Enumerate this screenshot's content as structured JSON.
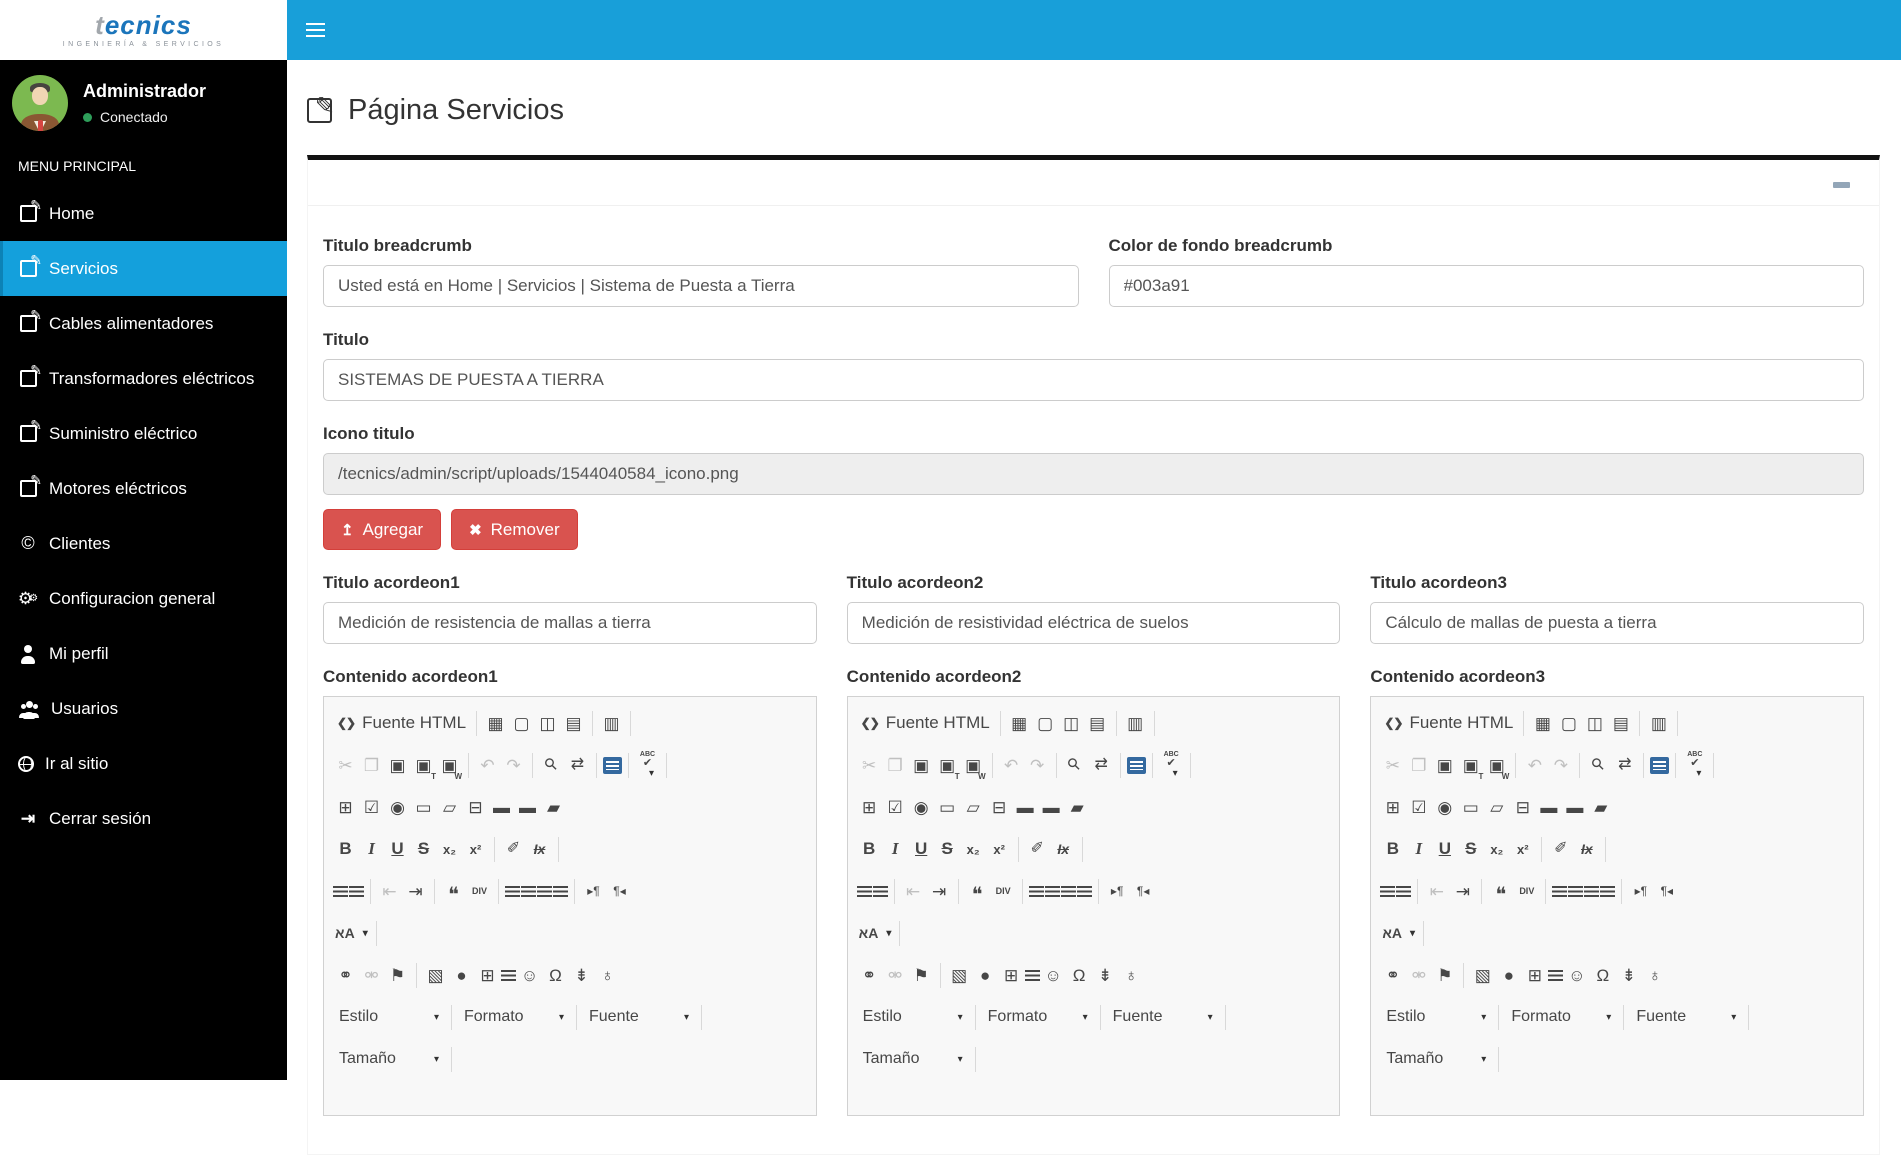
{
  "sidebar": {
    "logo": {
      "brand_prefix": "t",
      "brand_mid": "ecnic",
      "brand_suffix": "s",
      "tagline": "INGENIERÍA & SERVICIOS"
    },
    "user": {
      "name": "Administrador",
      "status": "Conectado"
    },
    "menu_header": "MENU PRINCIPAL",
    "items": [
      {
        "label": "Home",
        "icon": "edit-icon",
        "active": false
      },
      {
        "label": "Servicios",
        "icon": "edit-icon",
        "active": true
      },
      {
        "label": "Cables alimentadores",
        "icon": "edit-icon",
        "active": false
      },
      {
        "label": "Transformadores eléctricos",
        "icon": "edit-icon",
        "active": false
      },
      {
        "label": "Suministro eléctrico",
        "icon": "edit-icon",
        "active": false
      },
      {
        "label": "Motores eléctricos",
        "icon": "edit-icon",
        "active": false
      },
      {
        "label": "Clientes",
        "icon": "copyright-icon",
        "active": false
      },
      {
        "label": "Configuracion general",
        "icon": "gears-icon",
        "active": false
      },
      {
        "label": "Mi perfil",
        "icon": "user-icon",
        "active": false
      },
      {
        "label": "Usuarios",
        "icon": "users-icon",
        "active": false
      },
      {
        "label": "Ir al sitio",
        "icon": "globe-icon",
        "active": false
      },
      {
        "label": "Cerrar sesión",
        "icon": "sign-out-icon",
        "active": false
      }
    ]
  },
  "page": {
    "title": "Página Servicios"
  },
  "form": {
    "titulo_breadcrumb": {
      "label": "Titulo breadcrumb",
      "value": "Usted está en Home | Servicios | Sistema de Puesta a Tierra"
    },
    "color_fondo": {
      "label": "Color de fondo breadcrumb",
      "value": "#003a91"
    },
    "titulo": {
      "label": "Titulo",
      "value": "SISTEMAS DE PUESTA A TIERRA"
    },
    "icono_titulo": {
      "label": "Icono titulo",
      "value": "/tecnics/admin/script/uploads/1544040584_icono.png"
    },
    "agregar_label": "Agregar",
    "remover_label": "Remover",
    "acordeones": [
      {
        "titulo_label": "Titulo acordeon1",
        "titulo_value": "Medición de resistencia de mallas a tierra",
        "contenido_label": "Contenido acordeon1"
      },
      {
        "titulo_label": "Titulo acordeon2",
        "titulo_value": "Medición de resistividad eléctrica de suelos",
        "contenido_label": "Contenido acordeon2"
      },
      {
        "titulo_label": "Titulo acordeon3",
        "titulo_value": "Cálculo de mallas de puesta a tierra",
        "contenido_label": "Contenido acordeon3"
      }
    ]
  },
  "editor": {
    "toolbar_rows": [
      [
        {
          "n": "source-button",
          "g": "❮❯",
          "t": "Fuente HTML",
          "c": "srcbtn"
        },
        {
          "s": 1
        },
        {
          "n": "save-icon",
          "g": "▦"
        },
        {
          "n": "new-page-icon",
          "g": "▢"
        },
        {
          "n": "preview-icon",
          "g": "◫"
        },
        {
          "n": "print-icon",
          "g": "▤"
        },
        {
          "s": 1
        },
        {
          "n": "templates-icon",
          "g": "▥"
        },
        {
          "s": 1
        }
      ],
      [
        {
          "n": "cut-icon",
          "g": "✂",
          "d": 1
        },
        {
          "n": "copy-icon",
          "g": "❐",
          "d": 1
        },
        {
          "n": "paste-icon",
          "g": "▣"
        },
        {
          "n": "paste-text-icon",
          "g": "▣",
          "sub": "T"
        },
        {
          "n": "paste-word-icon",
          "g": "▣",
          "sub": "W"
        },
        {
          "s": 1
        },
        {
          "n": "undo-icon",
          "g": "↶",
          "d": 1
        },
        {
          "n": "redo-icon",
          "g": "↷",
          "d": 1
        },
        {
          "s": 1
        },
        {
          "n": "find-icon",
          "g": "⚲",
          "c": "rot"
        },
        {
          "n": "replace-icon",
          "g": "⇄",
          "c": "rep"
        },
        {
          "s": 1
        },
        {
          "n": "select-all-icon",
          "c": "selall"
        },
        {
          "s": 1
        },
        {
          "n": "spellcheck-icon",
          "g": "✔",
          "c": "spell",
          "caret": 1
        },
        {
          "s": 1
        }
      ],
      [
        {
          "n": "form-icon",
          "g": "⊞"
        },
        {
          "n": "checkbox-icon",
          "g": "☑"
        },
        {
          "n": "radio-icon",
          "g": "◉"
        },
        {
          "n": "text-field-icon",
          "g": "▭"
        },
        {
          "n": "textarea-icon",
          "g": "▱"
        },
        {
          "n": "select-field-icon",
          "g": "⊟"
        },
        {
          "n": "button-icon",
          "g": "▬"
        },
        {
          "n": "image-button-icon",
          "g": "▬"
        },
        {
          "n": "hidden-field-icon",
          "g": "▰"
        }
      ],
      [
        {
          "n": "bold-icon",
          "t": "B",
          "c": "tb-b"
        },
        {
          "n": "italic-icon",
          "t": "I",
          "c": "tb-i"
        },
        {
          "n": "underline-icon",
          "t": "U",
          "c": "tb-u"
        },
        {
          "n": "strike-icon",
          "t": "S",
          "c": "tb-s"
        },
        {
          "n": "subscript-icon",
          "t": "x₂",
          "c": "tb-xs"
        },
        {
          "n": "superscript-icon",
          "t": "x²",
          "c": "tb-xs"
        },
        {
          "s": 1
        },
        {
          "n": "copy-format-icon",
          "g": "✐",
          "c": "brush"
        },
        {
          "n": "remove-format-icon",
          "t": "Ix",
          "c": "tb-rf"
        },
        {
          "s": 1
        }
      ],
      [
        {
          "n": "ordered-list-icon",
          "c": "bars"
        },
        {
          "n": "bullet-list-icon",
          "c": "bars"
        },
        {
          "s": 1
        },
        {
          "n": "outdent-icon",
          "g": "⇤",
          "d": 1
        },
        {
          "n": "indent-icon",
          "g": "⇥"
        },
        {
          "s": 1
        },
        {
          "n": "blockquote-icon",
          "g": "❝",
          "c": "quote"
        },
        {
          "n": "div-icon",
          "t": "DIV",
          "c": "tb-div"
        },
        {
          "s": 1
        },
        {
          "n": "align-left-icon",
          "c": "bars"
        },
        {
          "n": "align-center-icon",
          "c": "bars"
        },
        {
          "n": "align-right-icon",
          "c": "bars"
        },
        {
          "n": "justify-icon",
          "c": "bars"
        },
        {
          "s": 1
        },
        {
          "n": "ltr-icon",
          "t": "▸¶",
          "c": "tb-dir"
        },
        {
          "n": "rtl-icon",
          "t": "¶◂",
          "c": "tb-dir"
        }
      ],
      [
        {
          "n": "language-icon",
          "t": "אA",
          "c": "tb-lang",
          "caret": 1
        },
        {
          "s": 1
        }
      ],
      [
        {
          "n": "link-icon",
          "g": "⚭"
        },
        {
          "n": "unlink-icon",
          "g": "⚮",
          "d": 1
        },
        {
          "n": "anchor-icon",
          "g": "⚑"
        },
        {
          "s": 1
        },
        {
          "n": "image-icon",
          "g": "▧"
        },
        {
          "n": "flash-icon",
          "g": "●"
        },
        {
          "n": "table-icon",
          "g": "⊞"
        },
        {
          "n": "hr-icon",
          "c": "bars"
        },
        {
          "n": "smiley-icon",
          "g": "☺"
        },
        {
          "n": "special-char-icon",
          "g": "Ω"
        },
        {
          "n": "page-break-icon",
          "g": "⇟"
        },
        {
          "n": "iframe-icon",
          "g": "♁"
        }
      ],
      [
        {
          "combo": "Estilo",
          "n": "styles-combo"
        },
        {
          "s": 1
        },
        {
          "combo": "Formato",
          "n": "format-combo"
        },
        {
          "s": 1
        },
        {
          "combo": "Fuente",
          "n": "font-combo"
        },
        {
          "s": 1
        }
      ],
      [
        {
          "combo": "Tamaño",
          "n": "size-combo"
        },
        {
          "s": 1
        }
      ]
    ]
  },
  "colors": {
    "topbar": "#189fd9",
    "active_item": "#14a0dc",
    "danger": "#d9534f",
    "brand_blue": "#1b75bb",
    "online_green": "#2e9e5a",
    "breadcrumb_value": "#003a91"
  }
}
